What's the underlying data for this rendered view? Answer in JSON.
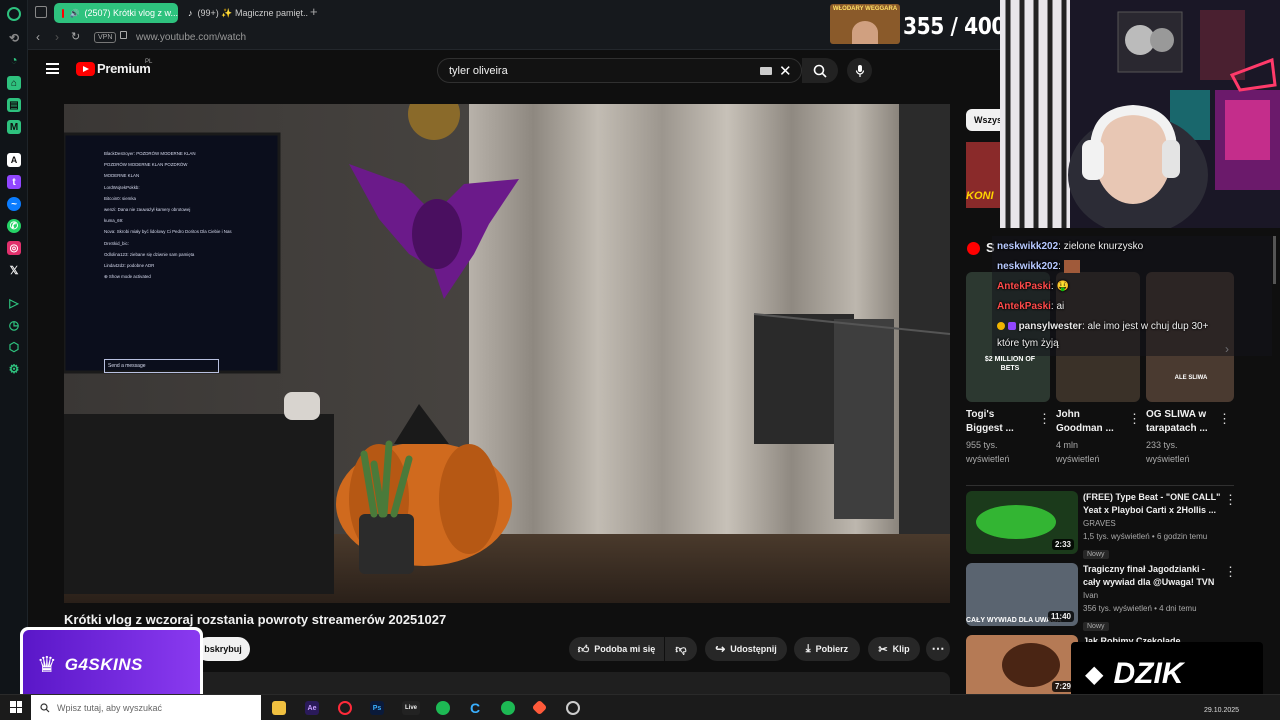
{
  "browser": {
    "tabs": [
      {
        "title": "(2507) Krótki vlog z w...",
        "active": true
      },
      {
        "title": "(99+) ✨ Magiczne pamięt...",
        "active": false
      }
    ],
    "vpn_badge": "VPN",
    "url": "www.youtube.com/watch"
  },
  "youtube": {
    "logo_text": "Premium",
    "logo_region": "PL",
    "search_value": "tyler oliveira",
    "video_title": "Krótki vlog z wczoraj rozstania powroty streamerów 20251027",
    "actions": {
      "subscribe_partial": "bskrybuj",
      "like": "Podoba mi się",
      "share": "Udostępnij",
      "download": "Pobierz",
      "clip": "Klip"
    },
    "chip_partial": "Wszys",
    "shorts_label_partial": "S",
    "shorts": [
      {
        "title_line1": "Togi's",
        "title_line2": "Biggest ...",
        "views": "955 tys.",
        "views_label": "wyświetleń",
        "thumb_text": "$2 MILLION OF BETS"
      },
      {
        "title_line1": "John",
        "title_line2": "Goodman ...",
        "views": "4 mln",
        "views_label": "wyświetleń",
        "thumb_text": ""
      },
      {
        "title_line1": "OG SLIWA w",
        "title_line2": "tarapatach ...",
        "views": "233 tys.",
        "views_label": "wyświetleń",
        "thumb_text": "ALE SLIWA"
      }
    ],
    "recommended": [
      {
        "title_line1": "(FREE) Type Beat - \"ONE CALL\" |",
        "title_line2": "Yeat x Playboi Carti x 2Hollis ...",
        "channel": "GRAVES",
        "meta": "1,5 tys. wyświetleń • 6 godzin temu",
        "badge": "Nowy",
        "duration": "2:33",
        "thumb_text": ""
      },
      {
        "title_line1": "Tragiczny finał Jagodzianki -",
        "title_line2": "cały wywiad dla @Uwaga! TVN",
        "channel": "Ivan",
        "meta": "356 tys. wyświetleń • 4 dni temu",
        "badge": "Nowy",
        "duration": "11:40",
        "thumb_text": "CAŁY WYWIAD DLA UWAGA"
      },
      {
        "title_line1": "Jak Robimy Czekolade",
        "title_line2": "",
        "channel": "",
        "meta": "",
        "badge": "",
        "duration": "7:29",
        "thumb_text": ""
      }
    ],
    "video_scene": {
      "tv_chat_lines": [
        "BlackDestroyer: POZDRÓW MODERNE KLAN",
        "POZDRÓW MODERNE KLAN POZDRÓW",
        "MODERNE KLAN",
        "LordWojtekPokkb:",
        "Bitcoin0: siemka",
        "wenzi: Dana nie zauważył kamery obrotowej",
        "kuma_69:",
        "Nova: Skrobi miały być lidolowy Ci Pedro Doritos Dla Ciebie i Nas",
        "DreSkid_bic:",
        "Odlolina123: ziebane się dziwnie sam pamięta",
        "Linda42d2: podobne ADR",
        "⊕ Show mode activated"
      ],
      "tv_chat_input": "Send a message"
    }
  },
  "overlay": {
    "counter": "355 / 400",
    "badge_text": "WŁODARY WEGGARA",
    "chat": [
      {
        "user": "neskwikk202",
        "message": "zielone knurzysko",
        "color": "#b7c9ff"
      },
      {
        "user": "neskwikk202",
        "message": "",
        "color": "#b7c9ff"
      },
      {
        "user": "AntekPaski",
        "message": "🤑",
        "color": "#ff4a4a"
      },
      {
        "user": "AntekPaski",
        "message": "ai",
        "color": "#ff4a4a"
      },
      {
        "user": "pansylwester",
        "message": "ale imo jest w chuj dup 30+",
        "color": "#e8e8e8"
      },
      {
        "user": "",
        "message": "które tym żyją",
        "color": "#e8e8e8"
      }
    ],
    "sponsor_left": "G4SKINS",
    "sponsor_right": "DZIK"
  },
  "taskbar": {
    "search_placeholder": "Wpisz tutaj, aby wyszukać",
    "date": "29.10.2025",
    "app_live_label": "Live"
  },
  "colors": {
    "yt_red": "#ff0000",
    "accent_purple": "#7b2ff0",
    "chat_blue": "#b7c9ff",
    "chat_red": "#ff4a4a"
  }
}
